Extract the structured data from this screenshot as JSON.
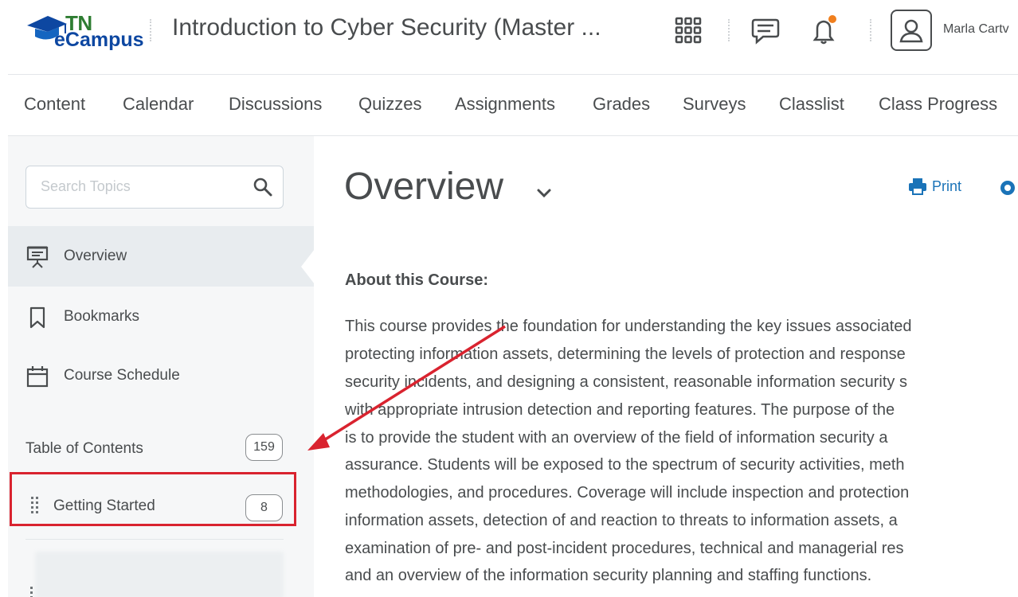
{
  "header": {
    "logo_tn": "TN",
    "logo_ecampus": "eCampus",
    "course_title": "Introduction to Cyber Security (Master ...",
    "user_name": "Marla Cartv",
    "icons": [
      "grid-icon",
      "message-icon",
      "bell-icon",
      "user-avatar-icon"
    ],
    "notification_dot_color": "#f07f1e"
  },
  "nav": {
    "items": [
      "Content",
      "Calendar",
      "Discussions",
      "Quizzes",
      "Assignments",
      "Grades",
      "Surveys",
      "Classlist",
      "Class Progress"
    ]
  },
  "sidebar": {
    "search_placeholder": "Search Topics",
    "items": [
      "Overview",
      "Bookmarks",
      "Course Schedule"
    ],
    "toc_label": "Table of Contents",
    "toc_count": "159",
    "module_label": "Getting Started",
    "module_count": "8"
  },
  "main": {
    "title": "Overview",
    "print_label": "Print",
    "about_heading": "About this Course:",
    "lines": [
      "This course provides the foundation for understanding the key issues associated",
      "protecting information assets, determining the levels of protection and response",
      "security incidents, and designing a consistent, reasonable information security s",
      "with appropriate intrusion detection and reporting features. The purpose of the",
      "is to provide the student with an overview of the field of information security a",
      "assurance. Students will be exposed to the spectrum of security activities, meth",
      "methodologies, and procedures. Coverage will include inspection and protection",
      "information assets, detection of and reaction to threats to information assets, a",
      "examination of pre- and post-incident procedures, technical and managerial res",
      "and an overview of the information security planning and staffing functions."
    ]
  },
  "annotation": {
    "highlight_color": "#d9232f"
  }
}
